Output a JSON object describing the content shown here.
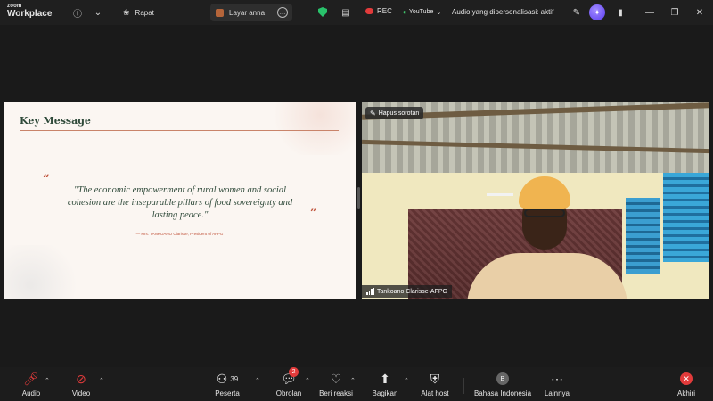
{
  "app": {
    "logo_top": "zoom",
    "logo_bottom": "Workplace"
  },
  "tabs": [
    {
      "label": "Rapat"
    },
    {
      "label": "Layar anna"
    }
  ],
  "topbar": {
    "rec_label": "REC",
    "youtube_label": "YouTube",
    "audio_status": "Audio yang dipersonalisasi: aktif"
  },
  "slide": {
    "title": "Key Message",
    "quote": "\"The economic empowerment of rural women and social cohesion are the inseparable pillars of food sovereignty and lasting peace.\"",
    "attribution": "— Mrs. TANKOANO Clarisse, President of AFPG",
    "open_mark": "“",
    "close_mark": "”"
  },
  "video": {
    "spotlight_label": "Hapus sorotan",
    "participant_name": "Tankoano Clarisse-AFPG"
  },
  "toolbar": {
    "audio": "Audio",
    "video": "Video",
    "participants": "Peserta",
    "participants_count": "39",
    "chat": "Obrolan",
    "chat_badge": "2",
    "reactions": "Beri reaksi",
    "share": "Bagikan",
    "host_tools": "Alat host",
    "language": "Bahasa Indonesia",
    "language_initial": "B",
    "more": "Lainnya",
    "end": "Akhiri"
  }
}
